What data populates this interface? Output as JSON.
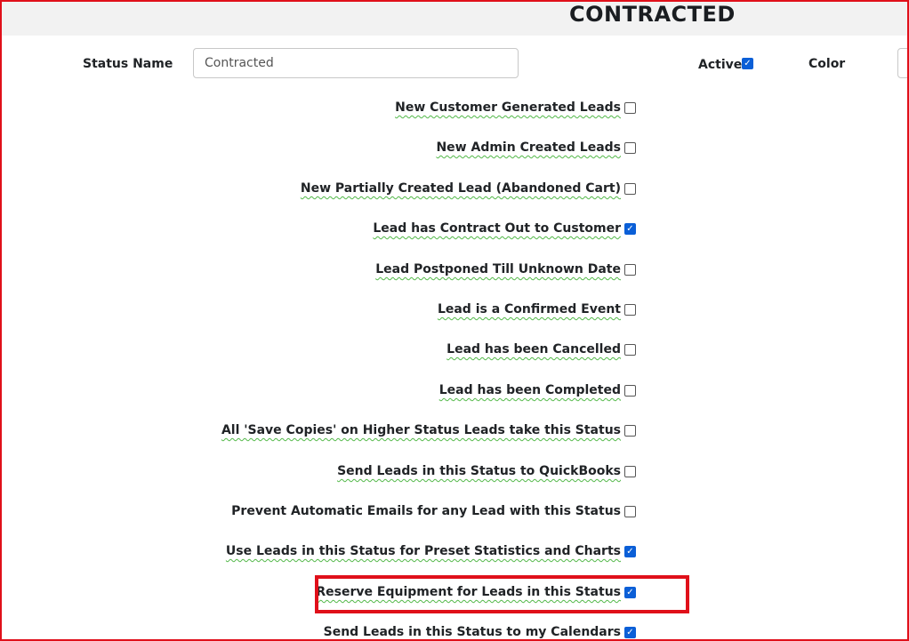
{
  "page": {
    "title": "CONTRACTED"
  },
  "form": {
    "status_name_label": "Status Name",
    "status_name_value": "Contracted",
    "active_label": "Active",
    "active_checked": true,
    "color_label": "Color"
  },
  "options": [
    {
      "label": "New Customer Generated Leads",
      "checked": false,
      "spell_marked": true
    },
    {
      "label": "New Admin Created Leads",
      "checked": false,
      "spell_marked": true
    },
    {
      "label": "New Partially Created Lead (Abandoned Cart)",
      "checked": false,
      "spell_marked": true
    },
    {
      "label": "Lead has Contract Out to Customer",
      "checked": true,
      "spell_marked": true
    },
    {
      "label": "Lead Postponed Till Unknown Date",
      "checked": false,
      "spell_marked": true
    },
    {
      "label": "Lead is a Confirmed Event",
      "checked": false,
      "spell_marked": true
    },
    {
      "label": "Lead has been Cancelled",
      "checked": false,
      "spell_marked": true
    },
    {
      "label": "Lead has been Completed",
      "checked": false,
      "spell_marked": true
    },
    {
      "label": "All 'Save Copies' on Higher Status Leads take this Status",
      "checked": false,
      "spell_marked": true
    },
    {
      "label": "Send Leads in this Status to QuickBooks",
      "checked": false,
      "spell_marked": true
    },
    {
      "label": "Prevent Automatic Emails for any Lead with this Status",
      "checked": false,
      "spell_marked": false
    },
    {
      "label": "Use Leads in this Status for Preset Statistics and Charts",
      "checked": true,
      "spell_marked": true
    },
    {
      "label": "Reserve Equipment for Leads in this Status",
      "checked": true,
      "spell_marked": true,
      "highlighted": true
    },
    {
      "label": "Send Leads in this Status to my Calendars",
      "checked": true,
      "spell_marked": false
    }
  ],
  "colors": {
    "highlight_border": "#e0101a",
    "checkbox_checked": "#0b5fd7",
    "spellcheck_underline": "#52b848"
  }
}
